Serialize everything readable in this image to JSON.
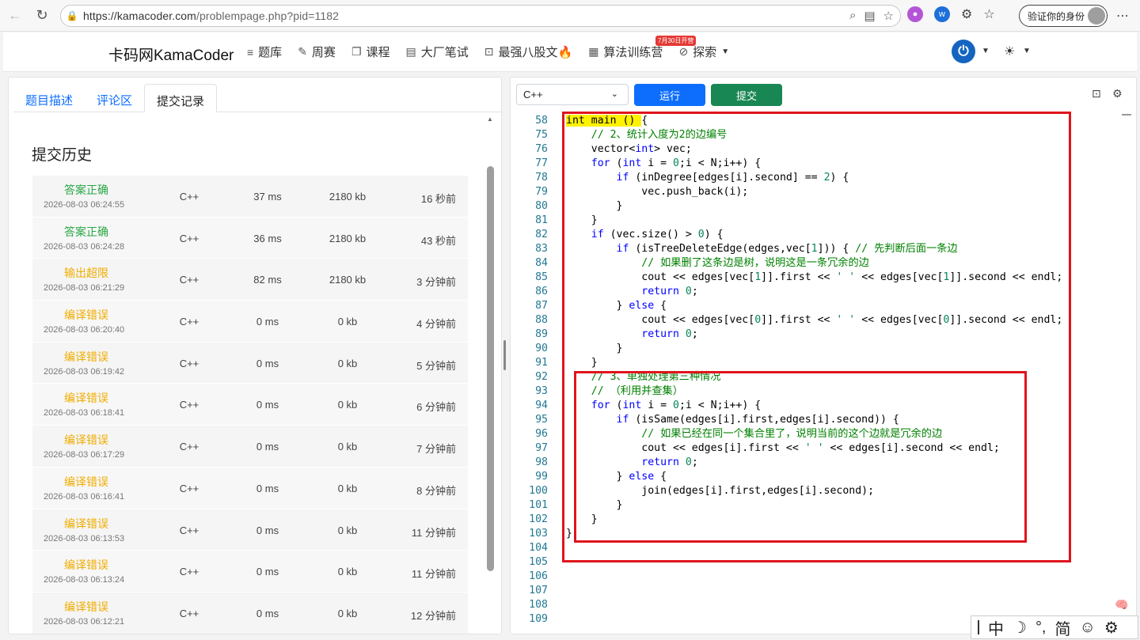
{
  "browser": {
    "url_host": "https://kamacoder.com",
    "url_path": "/problempage.php?pid=1182",
    "profile_label": "验证你的身份"
  },
  "header": {
    "brand": "卡码网KamaCoder",
    "menu": [
      {
        "icon": "list-icon",
        "label": "题库"
      },
      {
        "icon": "pen-icon",
        "label": "周赛"
      },
      {
        "icon": "copy-icon",
        "label": "课程"
      },
      {
        "icon": "notes-icon",
        "label": "大厂笔试"
      },
      {
        "icon": "doc-icon",
        "label": "最强八股文🔥"
      },
      {
        "icon": "calendar-icon",
        "label": "算法训练营"
      },
      {
        "icon": "compass-icon",
        "label": "探索"
      }
    ],
    "promo_badge": "7月30日开营"
  },
  "left": {
    "tabs": [
      "题目描述",
      "评论区",
      "提交记录"
    ],
    "active_tab": "提交记录",
    "section_title": "提交历史",
    "submissions": [
      {
        "status": "答案正确",
        "kind": "ok",
        "time": "2026-08-03 06:24:55",
        "lang": "C++",
        "runtime": "37 ms",
        "memory": "2180 kb",
        "ago": "16 秒前"
      },
      {
        "status": "答案正确",
        "kind": "ok",
        "time": "2026-08-03 06:24:28",
        "lang": "C++",
        "runtime": "36 ms",
        "memory": "2180 kb",
        "ago": "43 秒前"
      },
      {
        "status": "输出超限",
        "kind": "warn",
        "time": "2026-08-03 06:21:29",
        "lang": "C++",
        "runtime": "82 ms",
        "memory": "2180 kb",
        "ago": "3 分钟前"
      },
      {
        "status": "编译错误",
        "kind": "warn",
        "time": "2026-08-03 06:20:40",
        "lang": "C++",
        "runtime": "0 ms",
        "memory": "0 kb",
        "ago": "4 分钟前"
      },
      {
        "status": "编译错误",
        "kind": "warn",
        "time": "2026-08-03 06:19:42",
        "lang": "C++",
        "runtime": "0 ms",
        "memory": "0 kb",
        "ago": "5 分钟前"
      },
      {
        "status": "编译错误",
        "kind": "warn",
        "time": "2026-08-03 06:18:41",
        "lang": "C++",
        "runtime": "0 ms",
        "memory": "0 kb",
        "ago": "6 分钟前"
      },
      {
        "status": "编译错误",
        "kind": "warn",
        "time": "2026-08-03 06:17:29",
        "lang": "C++",
        "runtime": "0 ms",
        "memory": "0 kb",
        "ago": "7 分钟前"
      },
      {
        "status": "编译错误",
        "kind": "warn",
        "time": "2026-08-03 06:16:41",
        "lang": "C++",
        "runtime": "0 ms",
        "memory": "0 kb",
        "ago": "8 分钟前"
      },
      {
        "status": "编译错误",
        "kind": "warn",
        "time": "2026-08-03 06:13:53",
        "lang": "C++",
        "runtime": "0 ms",
        "memory": "0 kb",
        "ago": "11 分钟前"
      },
      {
        "status": "编译错误",
        "kind": "warn",
        "time": "2026-08-03 06:13:24",
        "lang": "C++",
        "runtime": "0 ms",
        "memory": "0 kb",
        "ago": "11 分钟前"
      },
      {
        "status": "编译错误",
        "kind": "warn",
        "time": "2026-08-03 06:12:21",
        "lang": "C++",
        "runtime": "0 ms",
        "memory": "0 kb",
        "ago": "12 分钟前"
      }
    ]
  },
  "right": {
    "language": "C++",
    "run_label": "运行",
    "submit_label": "提交",
    "code_lines": [
      {
        "n": "58",
        "html": "<span class=\"hl\">int main () </span>{"
      },
      {
        "n": "75",
        "html": "    <span class=\"cm\">// 2、统计入度为2的边编号</span>"
      },
      {
        "n": "76",
        "html": "    vector<<span class=\"kw\">int</span>> vec;"
      },
      {
        "n": "77",
        "html": "    <span class=\"kw\">for</span> (<span class=\"kw\">int</span> i = <span class=\"num\">0</span>;i < N;i++) {"
      },
      {
        "n": "78",
        "html": "        <span class=\"kw\">if</span> (inDegree[edges[i].second] == <span class=\"num\">2</span>) {"
      },
      {
        "n": "79",
        "html": "            vec.push_back(i);"
      },
      {
        "n": "80",
        "html": "        }"
      },
      {
        "n": "81",
        "html": "    }"
      },
      {
        "n": "82",
        "html": "    <span class=\"kw\">if</span> (vec.size() > <span class=\"num\">0</span>) {"
      },
      {
        "n": "83",
        "html": "        <span class=\"kw\">if</span> (isTreeDeleteEdge(edges,vec[<span class=\"num\">1</span>])) { <span class=\"cm\">// 先判断后面一条边</span>"
      },
      {
        "n": "84",
        "html": "            <span class=\"cm\">// 如果删了这条边是树，说明这是一条冗余的边</span>"
      },
      {
        "n": "85",
        "html": "            cout << edges[vec[<span class=\"num\">1</span>]].first << <span class=\"num\">' '</span> << edges[vec[<span class=\"num\">1</span>]].second << endl;"
      },
      {
        "n": "86",
        "html": "            <span class=\"kw\">return</span> <span class=\"num\">0</span>;"
      },
      {
        "n": "87",
        "html": "        } <span class=\"kw\">else</span> {"
      },
      {
        "n": "88",
        "html": "            cout << edges[vec[<span class=\"num\">0</span>]].first << <span class=\"num\">' '</span> << edges[vec[<span class=\"num\">0</span>]].second << endl;"
      },
      {
        "n": "89",
        "html": "            <span class=\"kw\">return</span> <span class=\"num\">0</span>;"
      },
      {
        "n": "90",
        "html": "        }"
      },
      {
        "n": "91",
        "html": "    }"
      },
      {
        "n": "92",
        "html": "    <span class=\"cm\">// 3、单独处理第三种情况</span>"
      },
      {
        "n": "93",
        "html": "    <span class=\"cm\">// （利用并查集）</span>"
      },
      {
        "n": "94",
        "html": "    <span class=\"kw\">for</span> (<span class=\"kw\">int</span> i = <span class=\"num\">0</span>;i < N;i++) {"
      },
      {
        "n": "95",
        "html": "        <span class=\"kw\">if</span> (isSame(edges[i].first,edges[i].second)) {"
      },
      {
        "n": "96",
        "html": "            <span class=\"cm\">// 如果已经在同一个集合里了，说明当前的这个边就是冗余的边</span>"
      },
      {
        "n": "97",
        "html": "            cout << edges[i].first << <span class=\"num\">' '</span> << edges[i].second << endl;"
      },
      {
        "n": "98",
        "html": "            <span class=\"kw\">return</span> <span class=\"num\">0</span>;"
      },
      {
        "n": "99",
        "html": "        } <span class=\"kw\">else</span> {"
      },
      {
        "n": "100",
        "html": "            join(edges[i].first,edges[i].second);"
      },
      {
        "n": "101",
        "html": "        }"
      },
      {
        "n": "102",
        "html": "    }"
      },
      {
        "n": "103",
        "html": "}"
      },
      {
        "n": "104",
        "html": ""
      },
      {
        "n": "105",
        "html": ""
      },
      {
        "n": "106",
        "html": ""
      },
      {
        "n": "107",
        "html": ""
      },
      {
        "n": "108",
        "html": ""
      },
      {
        "n": "109",
        "html": ""
      }
    ]
  },
  "ime": {
    "items": [
      "中",
      "☽",
      "°,",
      "简",
      "☺",
      "⚙"
    ]
  },
  "colors": {
    "accent_blue": "#0d6efd",
    "submit_green": "#198754",
    "status_ok": "#28a745",
    "status_warn": "#f0ad00",
    "annotation_red": "#e0141c"
  }
}
